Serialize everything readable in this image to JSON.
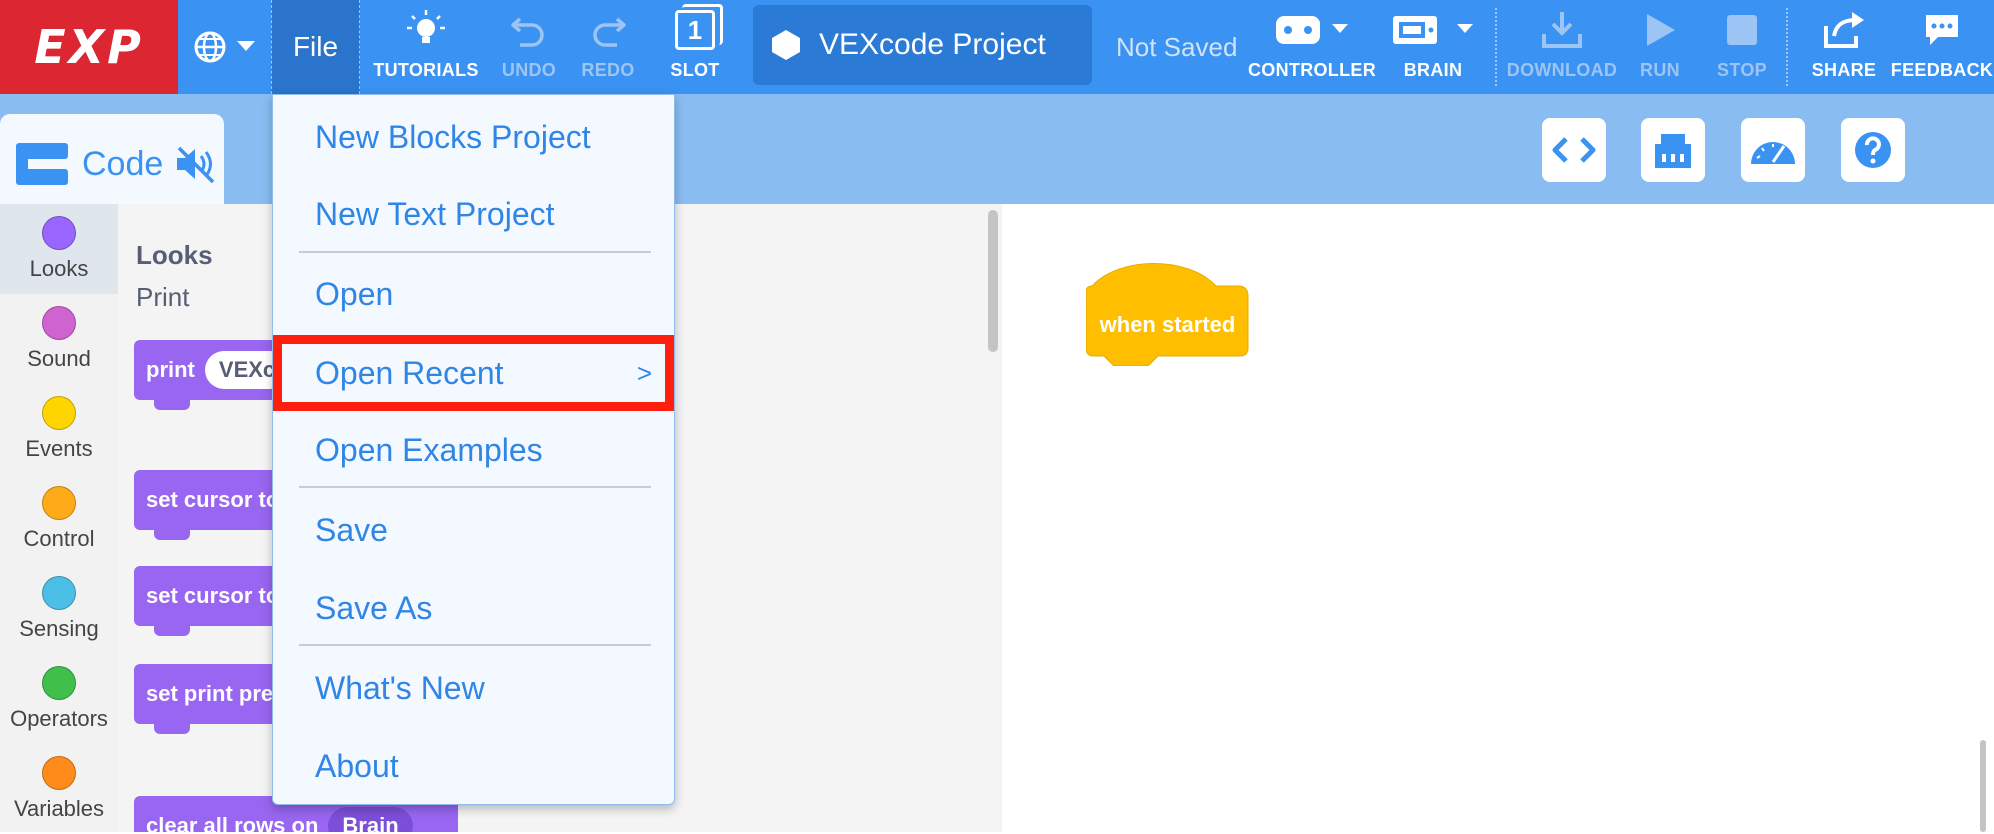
{
  "app": {
    "logo_text": "EXP"
  },
  "menubar": {
    "file_label": "File",
    "buttons": [
      {
        "key": "tutorials",
        "label": "TUTORIALS"
      },
      {
        "key": "undo",
        "label": "UNDO"
      },
      {
        "key": "redo",
        "label": "REDO"
      },
      {
        "key": "slot",
        "label": "SLOT",
        "slot_number": "1"
      },
      {
        "key": "controller",
        "label": "CONTROLLER"
      },
      {
        "key": "brain",
        "label": "BRAIN"
      },
      {
        "key": "download",
        "label": "DOWNLOAD"
      },
      {
        "key": "run",
        "label": "RUN"
      },
      {
        "key": "stop",
        "label": "STOP"
      },
      {
        "key": "share",
        "label": "SHARE"
      },
      {
        "key": "feedback",
        "label": "FEEDBACK"
      }
    ],
    "project_name": "VEXcode Project",
    "save_status": "Not Saved"
  },
  "subbar": {
    "code_tab_label": "Code"
  },
  "categories": [
    {
      "label": "Looks",
      "color": "#9966ff",
      "selected": true
    },
    {
      "label": "Sound",
      "color": "#cf63cf"
    },
    {
      "label": "Events",
      "color": "#ffd500"
    },
    {
      "label": "Control",
      "color": "#ffab19"
    },
    {
      "label": "Sensing",
      "color": "#4cbfe6"
    },
    {
      "label": "Operators",
      "color": "#40bf4a"
    },
    {
      "label": "Variables",
      "color": "#ff8c1a"
    }
  ],
  "flyout": {
    "title": "Looks",
    "subtitle": "Print",
    "blocks": [
      {
        "text": "print",
        "arg": "VEXc"
      },
      {
        "text": "set cursor to"
      },
      {
        "text": "set cursor to"
      },
      {
        "text": "set print pre"
      },
      {
        "text": "clear all rows on",
        "arg": "Brain"
      }
    ]
  },
  "workspace": {
    "hat_block_label": "when started"
  },
  "file_menu": {
    "items": [
      {
        "label": "New Blocks Project"
      },
      {
        "label": "New Text Project"
      },
      {
        "label": "Open"
      },
      {
        "label": "Open Recent",
        "submenu_arrow": ">",
        "highlighted": true
      },
      {
        "label": "Open Examples"
      },
      {
        "label": "Save"
      },
      {
        "label": "Save As"
      },
      {
        "label": "What's New"
      },
      {
        "label": "About"
      }
    ]
  },
  "colors": {
    "menubar_bg": "#3a92f2",
    "logo_bg": "#dc2632",
    "subbar_bg": "#89bdf2",
    "menu_text": "#2f86e6",
    "highlight_border": "#ff1f0f",
    "looks_block": "#9866f0",
    "events_block": "#ffbf00"
  }
}
